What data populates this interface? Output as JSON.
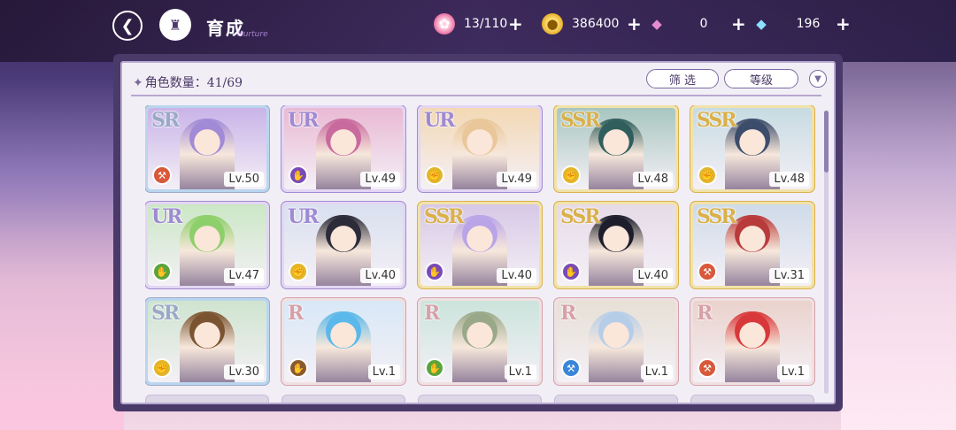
{
  "header": {
    "title": "育成",
    "subtitle": "Nurture"
  },
  "resources": [
    {
      "name": "candy",
      "icon": "candy-icon",
      "value": "13/110"
    },
    {
      "name": "coin",
      "icon": "coin-icon",
      "value": "386400"
    },
    {
      "name": "pink-diamond",
      "icon": "pink-diamond-icon",
      "value": "0"
    },
    {
      "name": "blue-diamond",
      "icon": "blue-diamond-icon",
      "value": "196"
    }
  ],
  "panel": {
    "count_label": "角色数量：41/69",
    "filter_label": "筛 选",
    "sort_label": "等级"
  },
  "cards": [
    {
      "rarity": "SR",
      "level": "Lv.50",
      "element": "red",
      "art": "#c9b3e8",
      "hair": "#a18ad6"
    },
    {
      "rarity": "UR",
      "level": "Lv.49",
      "element": "purple",
      "art": "#e9b9d4",
      "hair": "#c86a9e"
    },
    {
      "rarity": "UR",
      "level": "Lv.49",
      "element": "yellow",
      "art": "#f3d8b4",
      "hair": "#e9c79a"
    },
    {
      "rarity": "SSR",
      "level": "Lv.48",
      "element": "yellow",
      "art": "#a8c6c0",
      "hair": "#2f5e5c"
    },
    {
      "rarity": "SSR",
      "level": "Lv.48",
      "element": "yellow",
      "art": "#c7dbe2",
      "hair": "#3c4d6b"
    },
    {
      "rarity": "UR",
      "level": "Lv.47",
      "element": "green",
      "art": "#cbe7c6",
      "hair": "#8dcf6a"
    },
    {
      "rarity": "UR",
      "level": "Lv.40",
      "element": "yellow",
      "art": "#d9e0ef",
      "hair": "#2b2b3a"
    },
    {
      "rarity": "SSR",
      "level": "Lv.40",
      "element": "purple",
      "art": "#d7c8e6",
      "hair": "#b9a4e8"
    },
    {
      "rarity": "SSR",
      "level": "Lv.40",
      "element": "purple",
      "art": "#e6dbe8",
      "hair": "#1d1d2c"
    },
    {
      "rarity": "SSR",
      "level": "Lv.31",
      "element": "red",
      "art": "#cfdbe9",
      "hair": "#b83a3a"
    },
    {
      "rarity": "SR",
      "level": "Lv.30",
      "element": "yellow",
      "art": "#cfe4cf",
      "hair": "#7a5430"
    },
    {
      "rarity": "R",
      "level": "Lv.1",
      "element": "brown",
      "art": "#d8e8f7",
      "hair": "#5ab8ea"
    },
    {
      "rarity": "R",
      "level": "Lv.1",
      "element": "green",
      "art": "#cbe4dc",
      "hair": "#9aa88a"
    },
    {
      "rarity": "R",
      "level": "Lv.1",
      "element": "blue",
      "art": "#e7e0d6",
      "hair": "#b6cde8"
    },
    {
      "rarity": "R",
      "level": "Lv.1",
      "element": "red",
      "art": "#ead2cc",
      "hair": "#d8383a"
    }
  ],
  "colors": {
    "SR": "#9aa9c7",
    "UR": "#9f8ad2",
    "SSR": "#d9b04a",
    "R": "#d7a0a8",
    "frame_SR": "#b9d6ee",
    "frame_UR": "#e3d6f4",
    "frame_SSR": "#f1e2a8",
    "frame_R": "#efe0e2",
    "el_red": "#d8583a",
    "el_purple": "#7a4bb8",
    "el_yellow": "#e3b52a",
    "el_green": "#5aa53a",
    "el_brown": "#8a5a2e",
    "el_blue": "#3a86d8"
  }
}
